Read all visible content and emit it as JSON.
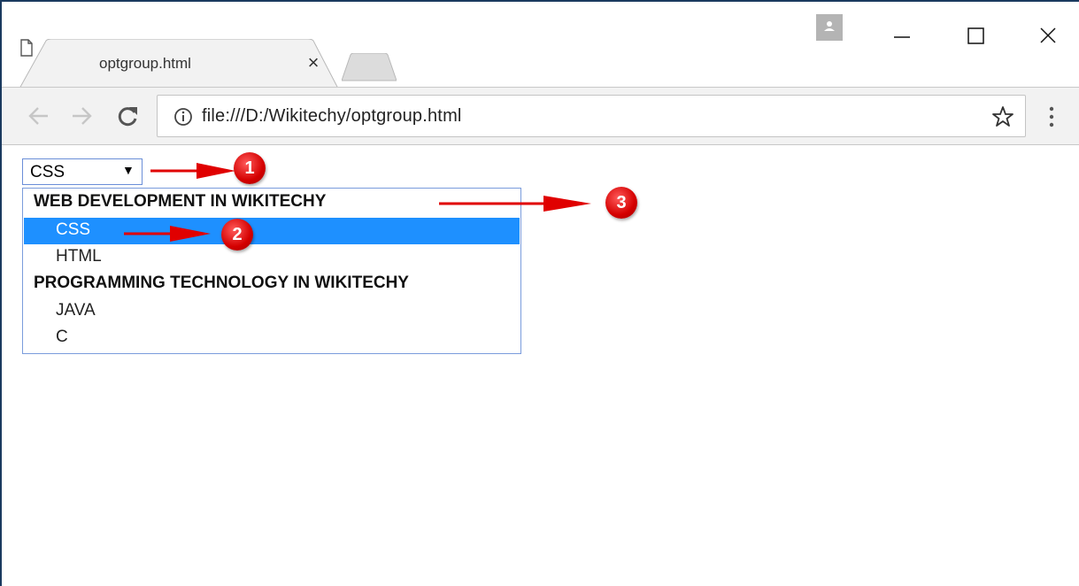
{
  "browser": {
    "tab": {
      "title": "optgroup.html",
      "close_glyph": "×"
    },
    "address": {
      "url": "file:///D:/Wikitechy/optgroup.html"
    },
    "icons": {
      "file": "file-icon",
      "back": "back-arrow-icon",
      "forward": "forward-arrow-icon",
      "reload": "reload-icon",
      "info": "info-icon",
      "star": "star-icon",
      "menu": "kebab-menu-icon",
      "profile": "profile-icon",
      "minimize": "minimize-icon",
      "maximize": "maximize-icon",
      "close": "close-icon"
    }
  },
  "page": {
    "select": {
      "value": "CSS",
      "arrow": "▼"
    },
    "dropdown": {
      "groups": [
        {
          "label": "WEB DEVELOPMENT IN WIKITECHY",
          "options": [
            "CSS",
            "HTML"
          ]
        },
        {
          "label": "PROGRAMMING TECHNOLOGY IN WIKITECHY",
          "options": [
            "JAVA",
            "C"
          ]
        }
      ],
      "selected_option": "CSS"
    },
    "annotations": [
      "1",
      "2",
      "3"
    ]
  },
  "colors": {
    "selection": "#1e90ff",
    "annotation": "#e00000",
    "toolbar": "#f2f2f2"
  }
}
